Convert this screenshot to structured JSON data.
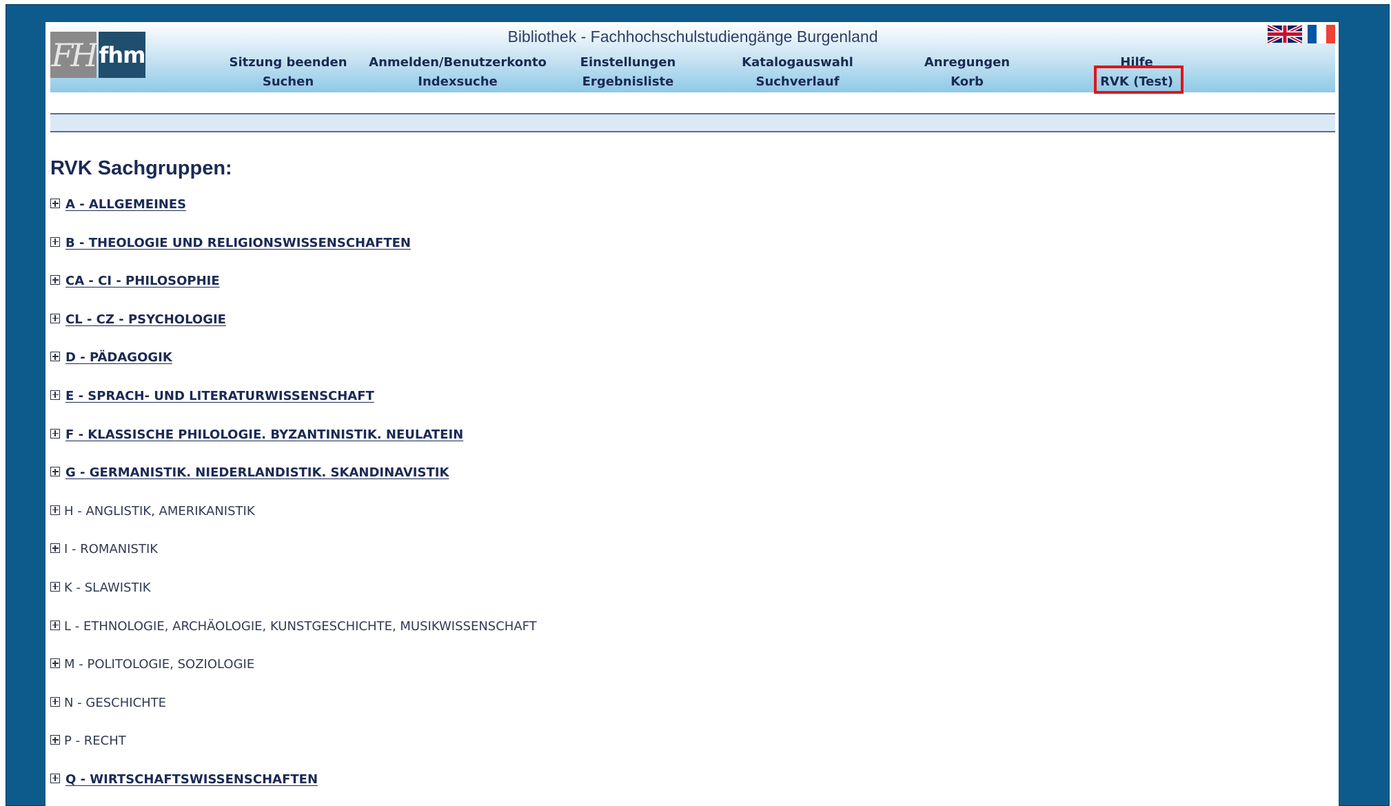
{
  "header": {
    "title": "Bibliothek - Fachhochschulstudiengänge Burgenland",
    "logo_left_text": "FH",
    "logo_right_text": "fhm",
    "flags": [
      "flag-uk-icon",
      "flag-fr-icon"
    ]
  },
  "nav": {
    "row1": [
      "Sitzung beenden",
      "Anmelden/Benutzerkonto",
      "Einstellungen",
      "Katalogauswahl",
      "Anregungen",
      "Hilfe"
    ],
    "row2": [
      "Suchen",
      "Indexsuche",
      "Ergebnisliste",
      "Suchverlauf",
      "Korb",
      "RVK (Test)"
    ]
  },
  "highlight_color": "#e0141b",
  "main": {
    "heading": "RVK Sachgruppen:",
    "categories": [
      {
        "label": "A - ALLGEMEINES",
        "link": true
      },
      {
        "label": "B - THEOLOGIE UND RELIGIONSWISSENSCHAFTEN",
        "link": true
      },
      {
        "label": "CA - CI - PHILOSOPHIE",
        "link": true
      },
      {
        "label": "CL - CZ - PSYCHOLOGIE",
        "link": true
      },
      {
        "label": "D - PÄDAGOGIK",
        "link": true
      },
      {
        "label": "E - SPRACH- UND LITERATURWISSENSCHAFT",
        "link": true
      },
      {
        "label": "F - KLASSISCHE PHILOLOGIE. BYZANTINISTIK. NEULATEIN",
        "link": true
      },
      {
        "label": "G - GERMANISTIK. NIEDERLANDISTIK. SKANDINAVISTIK",
        "link": true
      },
      {
        "label": "H - ANGLISTIK, AMERIKANISTIK",
        "link": false
      },
      {
        "label": "I - ROMANISTIK",
        "link": false
      },
      {
        "label": "K - SLAWISTIK",
        "link": false
      },
      {
        "label": "L - ETHNOLOGIE, ARCHÄOLOGIE, KUNSTGESCHICHTE, MUSIKWISSENSCHAFT",
        "link": false
      },
      {
        "label": "M - POLITOLOGIE, SOZIOLOGIE",
        "link": false
      },
      {
        "label": "N - GESCHICHTE",
        "link": false
      },
      {
        "label": "P - RECHT",
        "link": false
      },
      {
        "label": "Q - WIRTSCHAFTSWISSENSCHAFTEN",
        "link": true
      }
    ]
  }
}
